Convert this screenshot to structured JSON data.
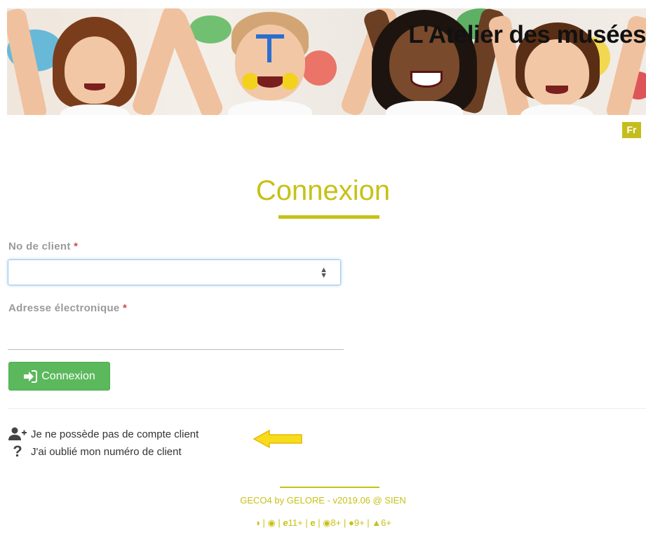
{
  "header": {
    "site_title": "L'Atelier des musées",
    "lang_label": "Fr"
  },
  "login": {
    "title": "Connexion",
    "client_number_label": "No de client",
    "email_label": "Adresse électronique",
    "required_marker": "*",
    "client_number_value": "",
    "email_value": "",
    "submit_label": "Connexion"
  },
  "links": {
    "no_account": "Je ne possède pas de compte client",
    "forgot_number": "J'ai oublié mon numéro de client"
  },
  "footer": {
    "credit": "GECO4 by GELORE - v2019.06 @ SIEN",
    "browsers": [
      {
        "icon": "firefox-icon",
        "version": ""
      },
      {
        "icon": "chrome-icon",
        "version": ""
      },
      {
        "icon": "ie-icon",
        "version": "11+"
      },
      {
        "icon": "edge-icon",
        "version": ""
      },
      {
        "icon": "safari-icon",
        "version": "8+"
      },
      {
        "icon": "apple-icon",
        "version": "9+"
      },
      {
        "icon": "android-icon",
        "version": "6+"
      }
    ]
  },
  "colors": {
    "accent": "#c7c115",
    "button": "#5cb85c",
    "required": "#d04a4a",
    "arrow": "#f7dc1e"
  }
}
